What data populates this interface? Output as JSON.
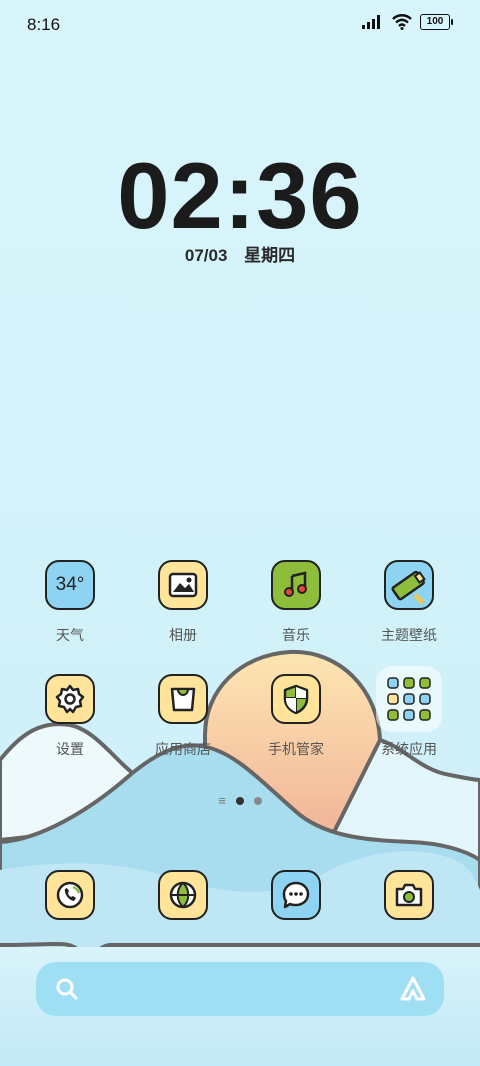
{
  "status_bar": {
    "time": "8:16",
    "battery": "100"
  },
  "lock_clock": {
    "time": "02:36",
    "date": "07/03",
    "weekday": "星期四"
  },
  "apps_row1": [
    {
      "name": "天气",
      "icon": "weather-icon",
      "value": "34°",
      "bg": "#8ed3f2"
    },
    {
      "name": "相册",
      "icon": "gallery-icon",
      "bg": "#ffe49a"
    },
    {
      "name": "音乐",
      "icon": "music-icon",
      "bg": "#8dbd3a"
    },
    {
      "name": "主题壁纸",
      "icon": "themes-icon",
      "bg": "#8ed3f2"
    }
  ],
  "apps_row2": [
    {
      "name": "设置",
      "icon": "settings-icon",
      "bg": "#ffe49a"
    },
    {
      "name": "应用商店",
      "icon": "app-store-icon",
      "bg": "#ffe49a"
    },
    {
      "name": "手机管家",
      "icon": "security-icon",
      "bg": "#ffe49a"
    },
    {
      "name": "系统应用",
      "icon": "folder-icon"
    }
  ],
  "dock": [
    {
      "icon": "phone-icon",
      "bg": "#ffe49a"
    },
    {
      "icon": "browser-icon",
      "bg": "#ffe49a"
    },
    {
      "icon": "messages-icon",
      "bg": "#8ed3f2"
    },
    {
      "icon": "camera-icon",
      "bg": "#ffe49a"
    }
  ],
  "colors": {
    "sky": "#d7f4fb",
    "accent_green": "#8dbd3a",
    "accent_yellow": "#ffe49a",
    "accent_blue": "#8ed3f2"
  }
}
